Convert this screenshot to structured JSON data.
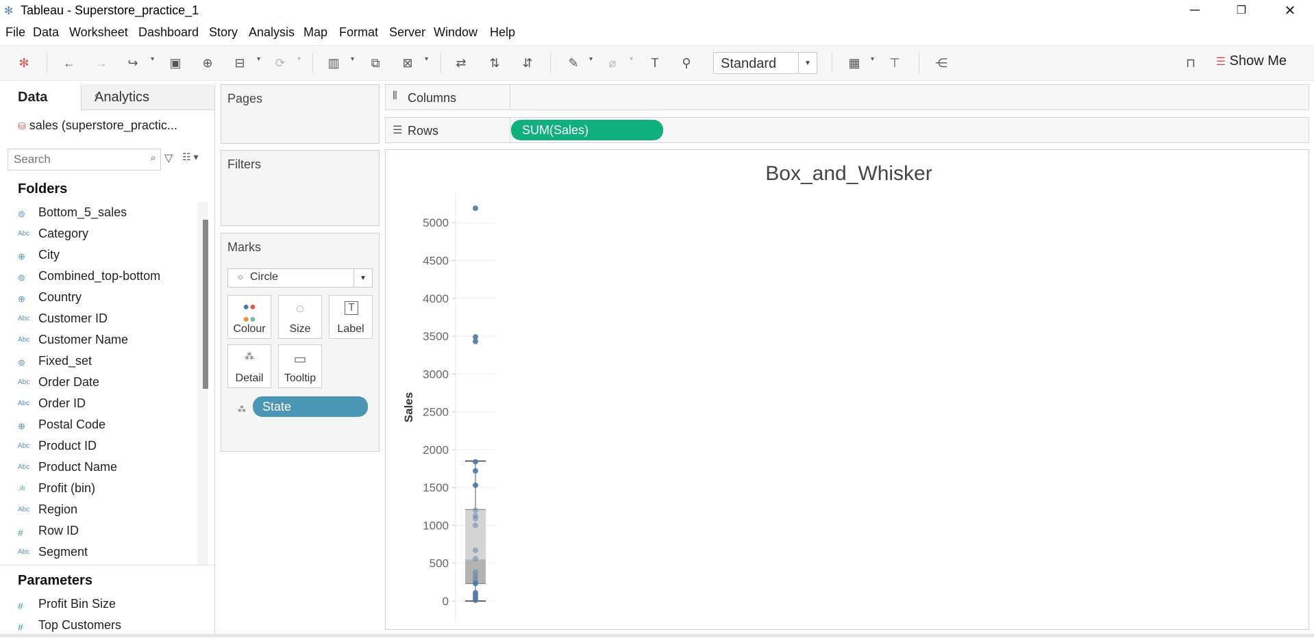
{
  "window": {
    "title": "Tableau - Superstore_practice_1"
  },
  "menu": [
    "File",
    "Data",
    "Worksheet",
    "Dashboard",
    "Story",
    "Analysis",
    "Map",
    "Format",
    "Server",
    "Window",
    "Help"
  ],
  "toolbar": {
    "fit_value": "Standard",
    "show_me_label": "Show Me"
  },
  "data_pane": {
    "tabs": [
      "Data",
      "Analytics"
    ],
    "datasource": "sales (superstore_practic...",
    "search_placeholder": "Search",
    "folders_heading": "Folders",
    "fields": [
      {
        "icon": "set-icon",
        "label": "Bottom_5_sales"
      },
      {
        "icon": "abc-icon",
        "label": "Category"
      },
      {
        "icon": "globe-icon",
        "label": "City"
      },
      {
        "icon": "set-icon",
        "label": "Combined_top-bottom"
      },
      {
        "icon": "globe-icon",
        "label": "Country"
      },
      {
        "icon": "abc-icon",
        "label": "Customer ID"
      },
      {
        "icon": "abc-icon",
        "label": "Customer Name"
      },
      {
        "icon": "set-icon",
        "label": "Fixed_set"
      },
      {
        "icon": "abc-icon",
        "label": "Order Date"
      },
      {
        "icon": "abc-icon",
        "label": "Order ID"
      },
      {
        "icon": "globe-icon",
        "label": "Postal Code"
      },
      {
        "icon": "abc-icon",
        "label": "Product ID"
      },
      {
        "icon": "abc-icon",
        "label": "Product Name"
      },
      {
        "icon": "bin-icon",
        "label": "Profit (bin)"
      },
      {
        "icon": "abc-icon",
        "label": "Region"
      },
      {
        "icon": "hash-icon",
        "label": "Row ID"
      },
      {
        "icon": "abc-icon",
        "label": "Segment"
      }
    ],
    "parameters_heading": "Parameters",
    "parameters": [
      {
        "icon": "hash-icon",
        "label": "Profit Bin Size"
      },
      {
        "icon": "hash-icon",
        "label": "Top Customers"
      }
    ]
  },
  "cards": {
    "pages": "Pages",
    "filters": "Filters",
    "marks": "Marks",
    "mark_type": "Circle",
    "mark_buttons": [
      "Colour",
      "Size",
      "Label",
      "Detail",
      "Tooltip"
    ],
    "detail_pill": "State"
  },
  "shelves": {
    "columns_label": "Columns",
    "rows_label": "Rows",
    "rows_pill": "SUM(Sales)"
  },
  "chart_data": {
    "type": "box-and-whisker",
    "title": "Box_and_Whisker",
    "ylabel": "Sales",
    "ylim": [
      0,
      5400
    ],
    "yticks": [
      0,
      500,
      1000,
      1500,
      2000,
      2500,
      3000,
      3500,
      4000,
      4500,
      5000
    ],
    "box": {
      "whisker_low": 0,
      "q1": 230,
      "median": 550,
      "q3": 1210,
      "whisker_high": 1850
    },
    "points": [
      5190,
      3490,
      3430,
      1840,
      1720,
      1530,
      1200,
      1130,
      1090,
      1000,
      670,
      560,
      380,
      330,
      290,
      250,
      230,
      110,
      80,
      40,
      10
    ]
  },
  "colors": {
    "accent_green": "#0fb07d",
    "state_pill": "#4c96b5",
    "point": "#4e79a7"
  }
}
